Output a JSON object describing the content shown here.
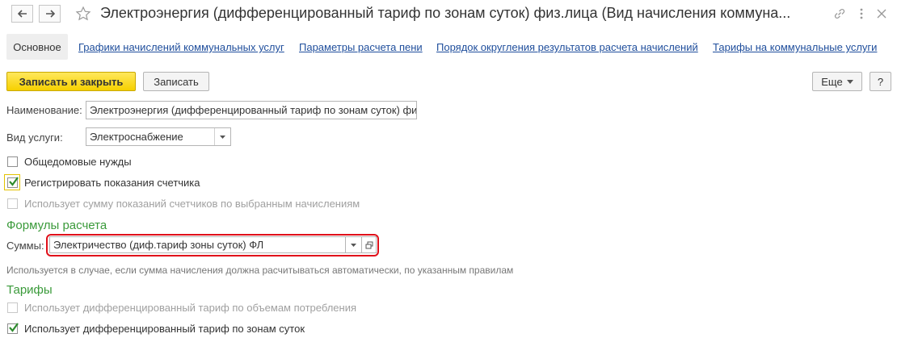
{
  "window": {
    "title": "Электроэнергия (дифференцированный тариф по зонам суток) физ.лица (Вид начисления коммуна...",
    "icons": [
      "arrow-left-icon",
      "arrow-right-icon",
      "star-icon",
      "link-icon",
      "more-vertical-icon",
      "close-icon"
    ]
  },
  "tabs": [
    {
      "label": "Основное",
      "active": true
    },
    {
      "label": "Графики начислений коммунальных услуг"
    },
    {
      "label": "Параметры расчета пени"
    },
    {
      "label": "Порядок округления результатов расчета начислений"
    },
    {
      "label": "Тарифы на коммунальные услуги"
    }
  ],
  "toolbar": {
    "save_close_label": "Записать и закрыть",
    "save_label": "Записать",
    "more_label": "Еще",
    "help_label": "?"
  },
  "form": {
    "name_label": "Наименование:",
    "name_value": "Электроэнергия (дифференцированный тариф по зонам суток) физ.",
    "service_label": "Вид услуги:",
    "service_value": "Электроснабжение",
    "checkboxes": [
      {
        "label": "Общедомовые нужды",
        "checked": false,
        "enabled": true
      },
      {
        "label": "Регистрировать показания счетчика",
        "checked": true,
        "enabled": true
      },
      {
        "label": "Использует сумму показаний счетчиков по выбранным начислениям",
        "checked": false,
        "enabled": false
      }
    ]
  },
  "formulas": {
    "section_title": "Формулы расчета",
    "sums_label": "Суммы:",
    "sums_value": "Электричество (диф.тариф зоны суток) ФЛ",
    "hint": "Используется в случае, если сумма начисления должна расчитываться автоматически, по указанным правилам"
  },
  "tariffs": {
    "section_title": "Тарифы",
    "checkboxes": [
      {
        "label": "Использует дифференцированный тариф по объемам потребления",
        "checked": false,
        "enabled": false
      },
      {
        "label": "Использует дифференцированный тариф по зонам суток",
        "checked": true,
        "enabled": true
      }
    ]
  },
  "colors": {
    "accent_yellow": "#f6d000",
    "section_green": "#3a9a3a",
    "link_blue": "#1f4e9c",
    "highlight_red": "#e0101a"
  }
}
